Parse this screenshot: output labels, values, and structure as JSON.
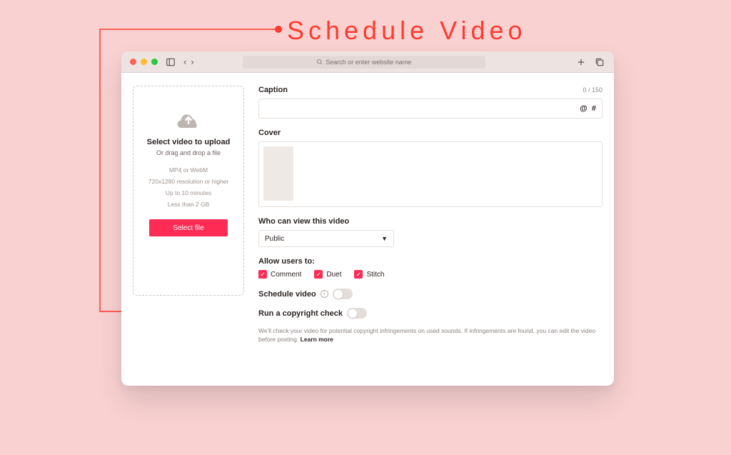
{
  "annotation": {
    "title": "Schedule Video"
  },
  "titlebar": {
    "search_placeholder": "Search or enter website name"
  },
  "upload": {
    "title": "Select video to upload",
    "subtitle": "Or drag and drop a file",
    "specs": [
      "MP4 or WebM",
      "720x1280 resolution or higher",
      "Up to 10 minutes",
      "Less than 2 GB"
    ],
    "button": "Select file"
  },
  "form": {
    "caption_label": "Caption",
    "caption_counter": "0 / 150",
    "cover_label": "Cover",
    "privacy_label": "Who can view this video",
    "privacy_value": "Public",
    "allow_label": "Allow users to:",
    "allow_options": [
      "Comment",
      "Duet",
      "Stitch"
    ],
    "schedule_label": "Schedule video",
    "copyright_label": "Run a copyright check",
    "copyright_text": "We'll check your video for potential copyright infringements on used sounds. If infringements are found, you can edit the video before posting.",
    "learn_more": "Learn more"
  }
}
